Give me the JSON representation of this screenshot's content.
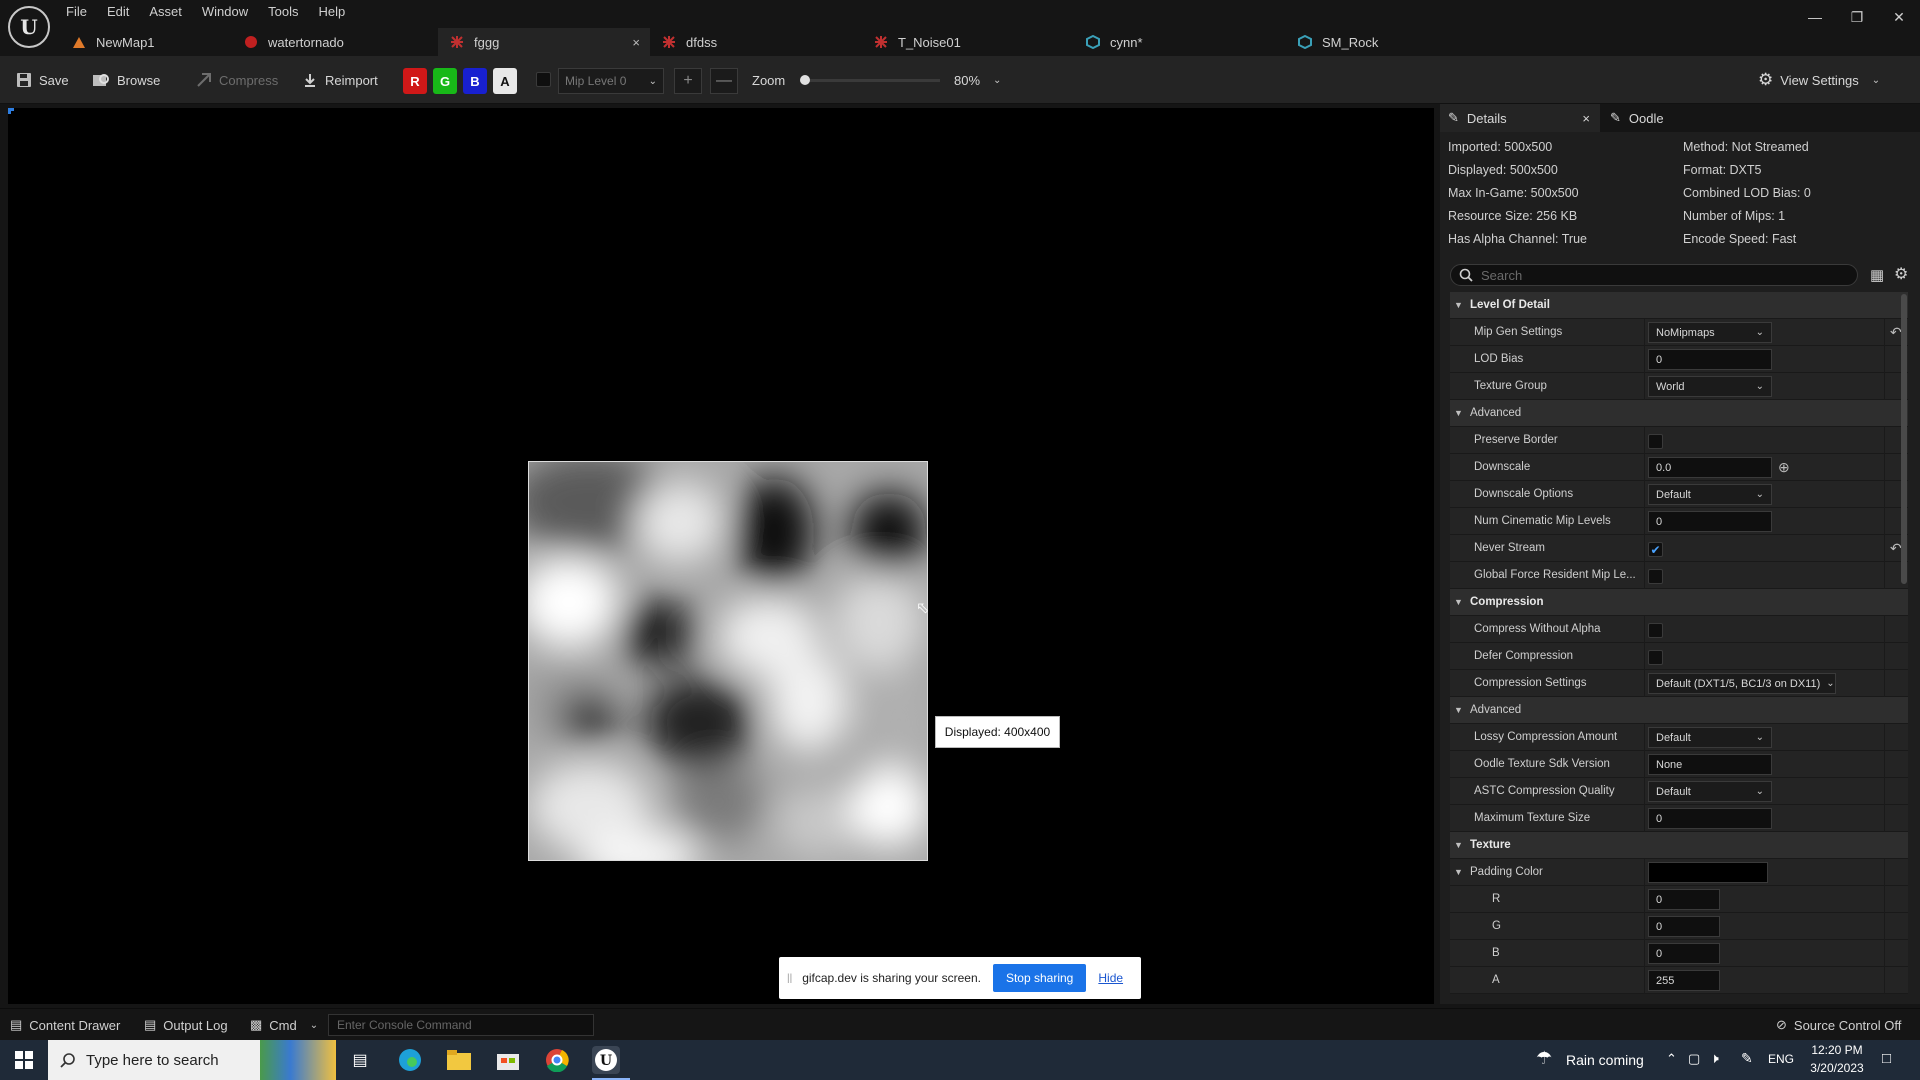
{
  "menu": [
    "File",
    "Edit",
    "Asset",
    "Window",
    "Tools",
    "Help"
  ],
  "tabs": [
    {
      "label": "NewMap1",
      "icon": "map-icon",
      "color": "#e07a2a"
    },
    {
      "label": "watertornado",
      "icon": "niagara-icon",
      "color": "#c02020"
    },
    {
      "label": "fggg",
      "icon": "texture-icon",
      "color": "#c03030",
      "active": true,
      "close": "×"
    },
    {
      "label": "dfdss",
      "icon": "texture-icon",
      "color": "#c03030"
    },
    {
      "label": "T_Noise01",
      "icon": "texture-icon",
      "color": "#c03030"
    },
    {
      "label": "cynn*",
      "icon": "mesh-icon",
      "color": "#3aa0b8"
    },
    {
      "label": "SM_Rock",
      "icon": "mesh-icon",
      "color": "#3aa0b8"
    }
  ],
  "toolbar": {
    "save": "Save",
    "browse": "Browse",
    "compress": "Compress",
    "reimport": "Reimport",
    "channels": [
      {
        "label": "R",
        "color": "#d01818"
      },
      {
        "label": "G",
        "color": "#18b818"
      },
      {
        "label": "B",
        "color": "#1820d0"
      },
      {
        "label": "A",
        "color": "#e8e8e8"
      }
    ],
    "mip_level": "Mip Level 0",
    "zoom_label": "Zoom",
    "zoom_value": "80%",
    "view_settings": "View Settings"
  },
  "viewport": {
    "tooltip": "Displayed: 400x400"
  },
  "share_bar": {
    "message": "gifcap.dev is sharing your screen.",
    "stop": "Stop sharing",
    "hide": "Hide"
  },
  "details": {
    "tab_details": "Details",
    "tab_oodle": "Oodle",
    "close": "×",
    "info_left": [
      "Imported: 500x500",
      "Displayed: 500x500",
      "Max In-Game: 500x500",
      "Resource Size: 256 KB",
      "Has Alpha Channel: True"
    ],
    "info_right": [
      "Method: Not Streamed",
      "Format: DXT5",
      "Combined LOD Bias: 0",
      "Number of Mips: 1",
      "Encode Speed: Fast"
    ],
    "search_placeholder": "Search",
    "rows": [
      {
        "kind": "cat",
        "label": "Level Of Detail",
        "indent": 0
      },
      {
        "kind": "dropdown",
        "label": "Mip Gen Settings",
        "value": "NoMipmaps",
        "reset": true
      },
      {
        "kind": "text",
        "label": "LOD Bias",
        "value": "0"
      },
      {
        "kind": "dropdown",
        "label": "Texture Group",
        "value": "World"
      },
      {
        "kind": "subcat",
        "label": "Advanced"
      },
      {
        "kind": "check",
        "label": "Preserve Border",
        "checked": false
      },
      {
        "kind": "text",
        "label": "Downscale",
        "value": "0.0",
        "add": true
      },
      {
        "kind": "dropdown",
        "label": "Downscale Options",
        "value": "Default"
      },
      {
        "kind": "text",
        "label": "Num Cinematic Mip Levels",
        "value": "0"
      },
      {
        "kind": "check",
        "label": "Never Stream",
        "checked": true,
        "reset": true
      },
      {
        "kind": "check",
        "label": "Global Force Resident Mip Le...",
        "checked": false
      },
      {
        "kind": "cat",
        "label": "Compression"
      },
      {
        "kind": "check",
        "label": "Compress Without Alpha",
        "checked": false
      },
      {
        "kind": "check",
        "label": "Defer Compression",
        "checked": false
      },
      {
        "kind": "dropdown-wide",
        "label": "Compression Settings",
        "value": "Default (DXT1/5, BC1/3 on DX11)"
      },
      {
        "kind": "subcat",
        "label": "Advanced"
      },
      {
        "kind": "dropdown",
        "label": "Lossy Compression Amount",
        "value": "Default"
      },
      {
        "kind": "text",
        "label": "Oodle Texture Sdk Version",
        "value": "None"
      },
      {
        "kind": "dropdown",
        "label": "ASTC Compression Quality",
        "value": "Default"
      },
      {
        "kind": "text",
        "label": "Maximum Texture Size",
        "value": "0"
      },
      {
        "kind": "cat",
        "label": "Texture"
      },
      {
        "kind": "color",
        "label": "Padding Color",
        "value": "#000000"
      },
      {
        "kind": "small",
        "label": "R",
        "value": "0"
      },
      {
        "kind": "small",
        "label": "G",
        "value": "0"
      },
      {
        "kind": "small",
        "label": "B",
        "value": "0"
      },
      {
        "kind": "small",
        "label": "A",
        "value": "255"
      }
    ]
  },
  "statusbar": {
    "content_drawer": "Content Drawer",
    "output_log": "Output Log",
    "cmd": "Cmd",
    "console_placeholder": "Enter Console Command",
    "source_control": "Source Control Off"
  },
  "taskbar": {
    "search_placeholder": "Type here to search",
    "weather": "Rain coming",
    "language": "ENG",
    "time": "12:20 PM",
    "date": "3/20/2023"
  }
}
